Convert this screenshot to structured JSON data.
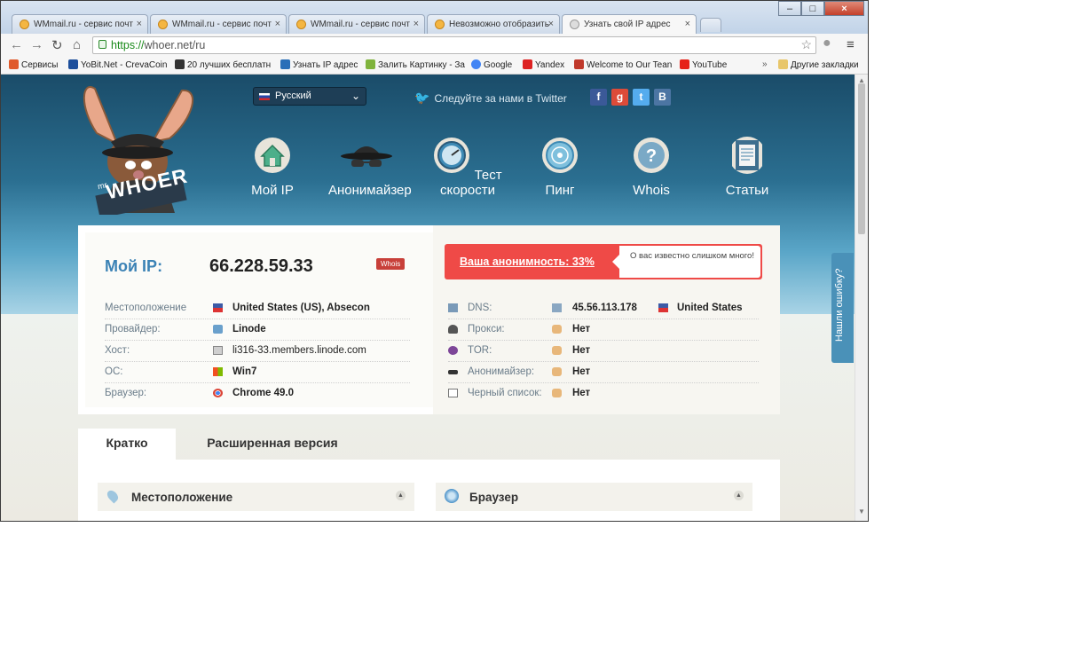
{
  "browser": {
    "tabs": [
      {
        "label": "WMmail.ru - сервис почт"
      },
      {
        "label": "WMmail.ru - сервис почт"
      },
      {
        "label": "WMmail.ru - сервис почт"
      },
      {
        "label": "Невозможно отобразить"
      },
      {
        "label": "Узнать свой IP адрес"
      }
    ],
    "url_scheme": "https://",
    "url_rest": "whoer.net/ru",
    "bookmarks": [
      {
        "label": "Сервисы",
        "color": "#e05a2b"
      },
      {
        "label": "YoBit.Net - CrevaCoin",
        "color": "#1d4f9c"
      },
      {
        "label": "20 лучших бесплатн",
        "color": "#333333"
      },
      {
        "label": "Узнать IP адрес",
        "color": "#2a6fb8"
      },
      {
        "label": "Залить Картинку - За",
        "color": "#7fb33c"
      },
      {
        "label": "Google",
        "color": "#4285f4"
      },
      {
        "label": "Yandex",
        "color": "#d22"
      },
      {
        "label": "Welcome to Our Tean",
        "color": "#c0392b"
      },
      {
        "label": "YouTube",
        "color": "#e62117"
      }
    ],
    "other_bookmarks": "Другие закладки"
  },
  "header": {
    "language": "Русский",
    "twitter": "Следуйте за нами в Twitter",
    "social": [
      {
        "icon": "facebook-icon",
        "glyph": "f",
        "color": "#3b5998"
      },
      {
        "icon": "google-icon",
        "glyph": "g",
        "color": "#dd4b39"
      },
      {
        "icon": "twitter-icon",
        "glyph": "t",
        "color": "#55acee"
      },
      {
        "icon": "vk-icon",
        "glyph": "B",
        "color": "#4c75a3"
      }
    ],
    "logo_text": "WHOER",
    "logo_prefix": "mr.",
    "nav": [
      {
        "label": "Мой IP",
        "icon": "home-icon"
      },
      {
        "label": "Анонимайзер",
        "icon": "spy-icon"
      },
      {
        "label": "Тест скорости",
        "icon": "speedometer-icon"
      },
      {
        "label": "Пинг",
        "icon": "radar-icon"
      },
      {
        "label": "Whois",
        "icon": "question-icon"
      },
      {
        "label": "Статьи",
        "icon": "document-icon"
      }
    ]
  },
  "ipinfo": {
    "label": "Мой IP:",
    "ip": "66.228.59.33",
    "whois_badge": "Whois",
    "anonymity": "Ваша анонимность: 33%",
    "anonymity_note": "О вас известно слишком много!",
    "left_rows": [
      {
        "label": "Местоположение",
        "value": "United States (US), Absecon",
        "icon": "us-flag-icon"
      },
      {
        "label": "Провайдер:",
        "value": "Linode",
        "icon": "provider-icon"
      },
      {
        "label": "Хост:",
        "value": "li316-33.members.linode.com",
        "icon": "host-icon"
      },
      {
        "label": "ОС:",
        "value": "Win7",
        "icon": "windows-icon"
      },
      {
        "label": "Браузер:",
        "value": "Chrome 49.0",
        "icon": "chrome-icon"
      }
    ],
    "right_rows": [
      {
        "label": "DNS:",
        "value": "45.56.113.178",
        "extra": "United States",
        "icon": "dns-icon"
      },
      {
        "label": "Прокси:",
        "value": "Нет",
        "icon": "proxy-icon"
      },
      {
        "label": "TOR:",
        "value": "Нет",
        "icon": "tor-icon"
      },
      {
        "label": "Анонимайзер:",
        "value": "Нет",
        "icon": "anonymizer-icon"
      },
      {
        "label": "Черный список:",
        "value": "Нет",
        "icon": "blacklist-icon"
      }
    ]
  },
  "tabs": {
    "brief": "Кратко",
    "extended": "Расширенная версия"
  },
  "sections": {
    "location": "Местоположение",
    "browser": "Браузер"
  },
  "side_tab": "Нашли ошибку?"
}
